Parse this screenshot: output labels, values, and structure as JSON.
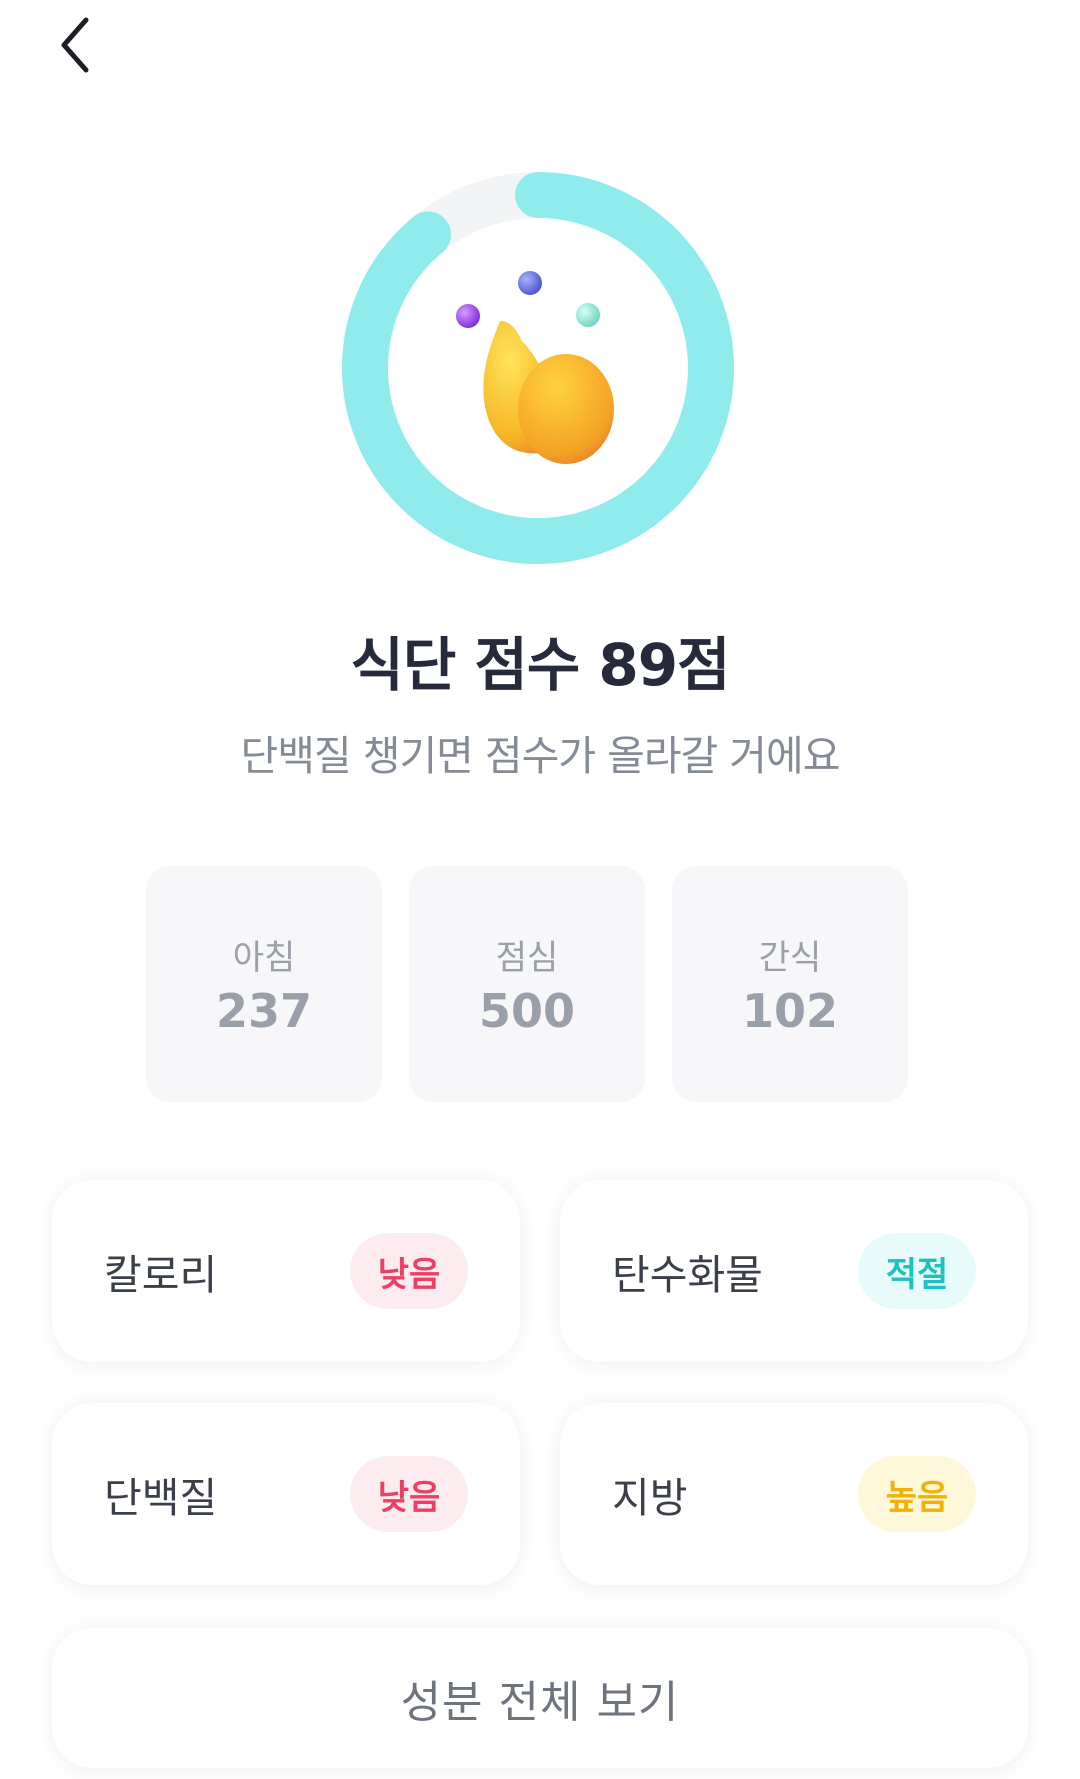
{
  "header": {
    "back_icon": "chevron-left-icon"
  },
  "score": {
    "title": "식단 점수 89점",
    "subtitle": "단백질 챙기면 점수가 올라갈 거에요",
    "progress": 0.89,
    "ring_color": "#90ecec",
    "track_color": "#f3f4f6"
  },
  "meals": [
    {
      "label": "아침",
      "value": "237"
    },
    {
      "label": "점심",
      "value": "500"
    },
    {
      "label": "간식",
      "value": "102"
    }
  ],
  "nutrients": [
    {
      "label": "칼로리",
      "status": "낮음",
      "level": "low"
    },
    {
      "label": "탄수화물",
      "status": "적절",
      "level": "ok"
    },
    {
      "label": "단백질",
      "status": "낮음",
      "level": "low"
    },
    {
      "label": "지방",
      "status": "높음",
      "level": "high"
    }
  ],
  "actions": {
    "view_all_label": "성분 전체 보기"
  },
  "colors": {
    "low": "#ec3f63",
    "ok": "#1ec0c0",
    "high": "#f2b109"
  }
}
